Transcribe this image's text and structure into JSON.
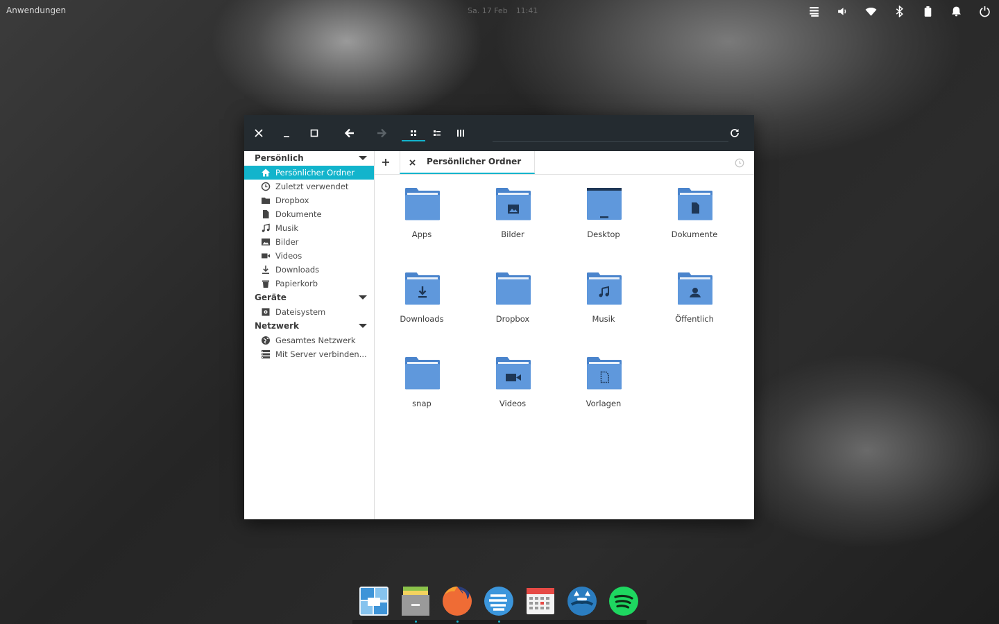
{
  "top_panel": {
    "apps_menu": "Anwendungen",
    "date": "Sa. 17 Feb",
    "time": "11:41",
    "tray_icons": [
      "stack-icon",
      "volume-icon",
      "wifi-icon",
      "bluetooth-icon",
      "battery-icon",
      "notifications-icon",
      "power-icon"
    ]
  },
  "window": {
    "headerbar": {
      "buttons": [
        "close-icon",
        "minimize-icon",
        "maximize-icon",
        "back-arrow-icon",
        "forward-arrow-icon",
        "grid-view-icon",
        "list-view-icon",
        "column-view-icon",
        "reload-icon"
      ],
      "active_view": "grid"
    },
    "sidebar": {
      "sections": [
        {
          "title": "Persönlich",
          "items": [
            {
              "label": "Persönlicher Ordner",
              "icon": "home-icon",
              "active": true
            },
            {
              "label": "Zuletzt verwendet",
              "icon": "clock-icon"
            },
            {
              "label": "Dropbox",
              "icon": "folder-icon"
            },
            {
              "label": "Dokumente",
              "icon": "document-icon"
            },
            {
              "label": "Musik",
              "icon": "music-icon"
            },
            {
              "label": "Bilder",
              "icon": "image-icon"
            },
            {
              "label": "Videos",
              "icon": "video-icon"
            },
            {
              "label": "Downloads",
              "icon": "download-icon"
            },
            {
              "label": "Papierkorb",
              "icon": "trash-icon"
            }
          ]
        },
        {
          "title": "Geräte",
          "items": [
            {
              "label": "Dateisystem",
              "icon": "drive-icon"
            }
          ]
        },
        {
          "title": "Netzwerk",
          "items": [
            {
              "label": "Gesamtes Netzwerk",
              "icon": "network-icon"
            },
            {
              "label": "Mit Server verbinden...",
              "icon": "server-icon"
            }
          ]
        }
      ]
    },
    "tab": {
      "label": "Persönlicher Ordner"
    },
    "files": [
      {
        "name": "Apps",
        "emblem": "none"
      },
      {
        "name": "Bilder",
        "emblem": "image"
      },
      {
        "name": "Desktop",
        "emblem": "desktop"
      },
      {
        "name": "Dokumente",
        "emblem": "document"
      },
      {
        "name": "Downloads",
        "emblem": "download"
      },
      {
        "name": "Dropbox",
        "emblem": "none"
      },
      {
        "name": "Musik",
        "emblem": "music"
      },
      {
        "name": "Öffentlich",
        "emblem": "person"
      },
      {
        "name": "snap",
        "emblem": "none"
      },
      {
        "name": "Videos",
        "emblem": "video"
      },
      {
        "name": "Vorlagen",
        "emblem": "template"
      }
    ]
  },
  "dock": {
    "apps": [
      "multitasking-view-icon",
      "files-app-icon",
      "firefox-icon",
      "app-store-icon",
      "calendar-icon",
      "web-browser-icon",
      "spotify-icon"
    ],
    "running": [
      1,
      2,
      3
    ]
  },
  "colors": {
    "accent": "#12b4cc",
    "headerbar": "#242b30",
    "folder_light": "#5f98dc",
    "folder_dark": "#4a84cc",
    "emblem": "#1e3756"
  }
}
